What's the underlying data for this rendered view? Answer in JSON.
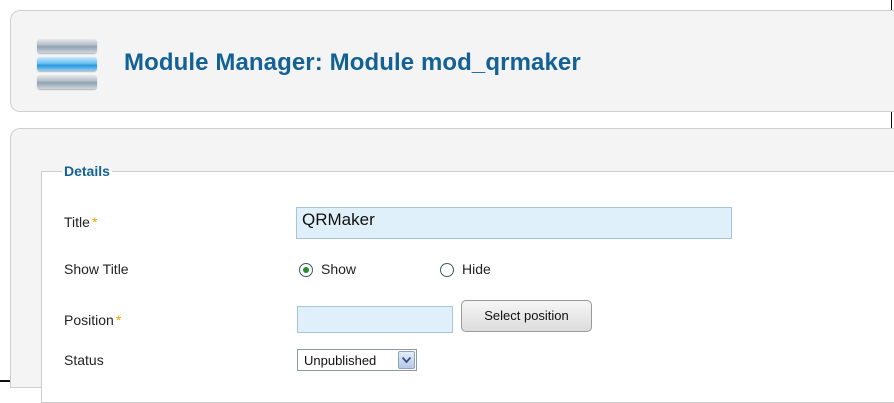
{
  "header": {
    "title": "Module Manager: Module mod_qrmaker",
    "logo_icon": "module-manager-icon"
  },
  "form": {
    "legend": "Details",
    "title": {
      "label": "Title",
      "required_mark": "*",
      "value": "QRMaker"
    },
    "show_title": {
      "label": "Show Title",
      "options": [
        {
          "label": "Show",
          "checked": true
        },
        {
          "label": "Hide",
          "checked": false
        }
      ]
    },
    "position": {
      "label": "Position",
      "required_mark": "*",
      "value": "",
      "button_label": "Select position"
    },
    "status": {
      "label": "Status",
      "selected": "Unpublished"
    }
  },
  "colors": {
    "title_blue": "#146295",
    "required_orange": "#f2a000",
    "input_bg": "#dff0fb"
  }
}
